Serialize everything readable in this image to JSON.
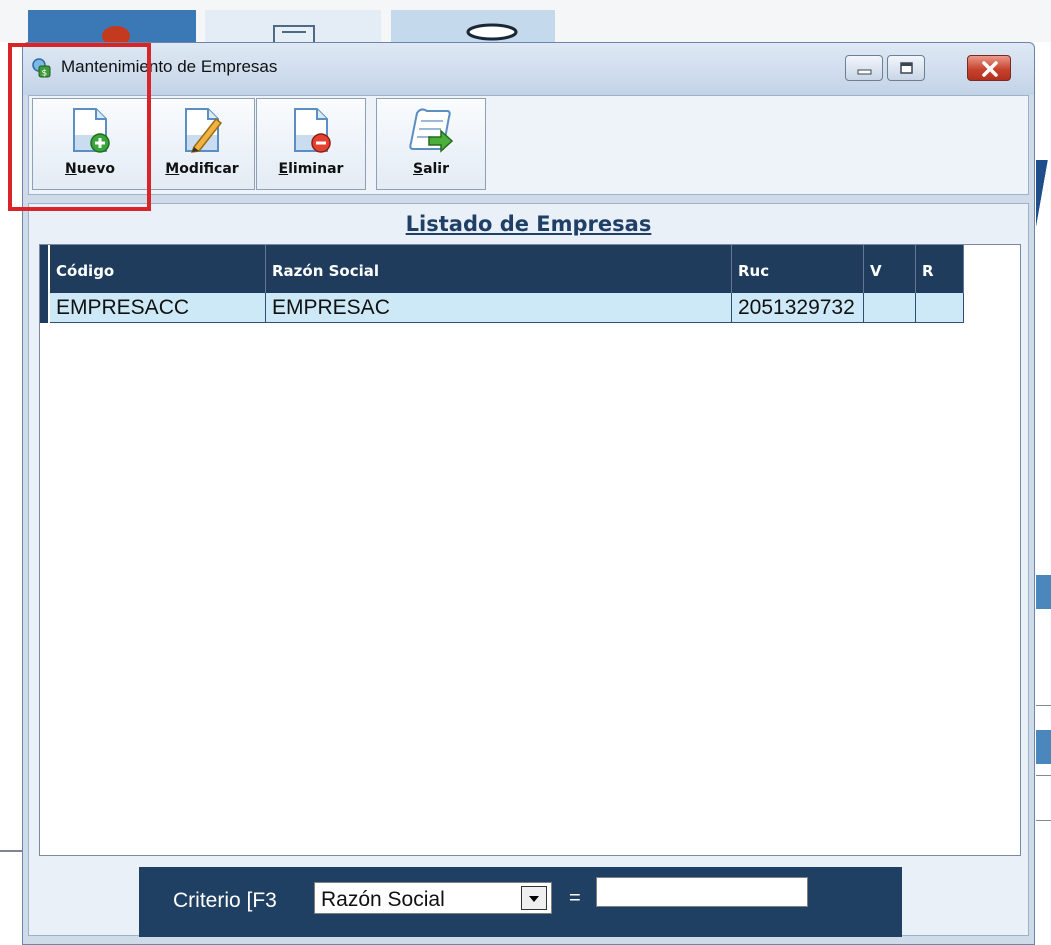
{
  "window": {
    "title": "Mantenimiento de Empresas"
  },
  "toolbar": {
    "buttons": [
      {
        "key": "N",
        "rest": "uevo",
        "icon": "new-document-icon"
      },
      {
        "key": "M",
        "rest": "odificar",
        "icon": "edit-document-icon"
      },
      {
        "key": "E",
        "rest": "liminar",
        "icon": "delete-document-icon"
      },
      {
        "key": "S",
        "rest": "alir",
        "icon": "exit-scroll-icon"
      }
    ]
  },
  "list": {
    "title": "Listado de Empresas",
    "columns": [
      "Código",
      "Razón Social",
      "Ruc",
      "V",
      "R"
    ],
    "rows": [
      [
        "EMPRESACC",
        "EMPRESAC",
        "2051329732",
        "",
        ""
      ]
    ]
  },
  "criteria": {
    "label": "Criterio [F3",
    "selected": "Razón Social",
    "equals": "=",
    "value": ""
  },
  "colors": {
    "header_bg": "#1f3c5c",
    "row_bg": "#cde9f8",
    "highlight": "#d9242a",
    "title_blue": "#1f3f66"
  }
}
